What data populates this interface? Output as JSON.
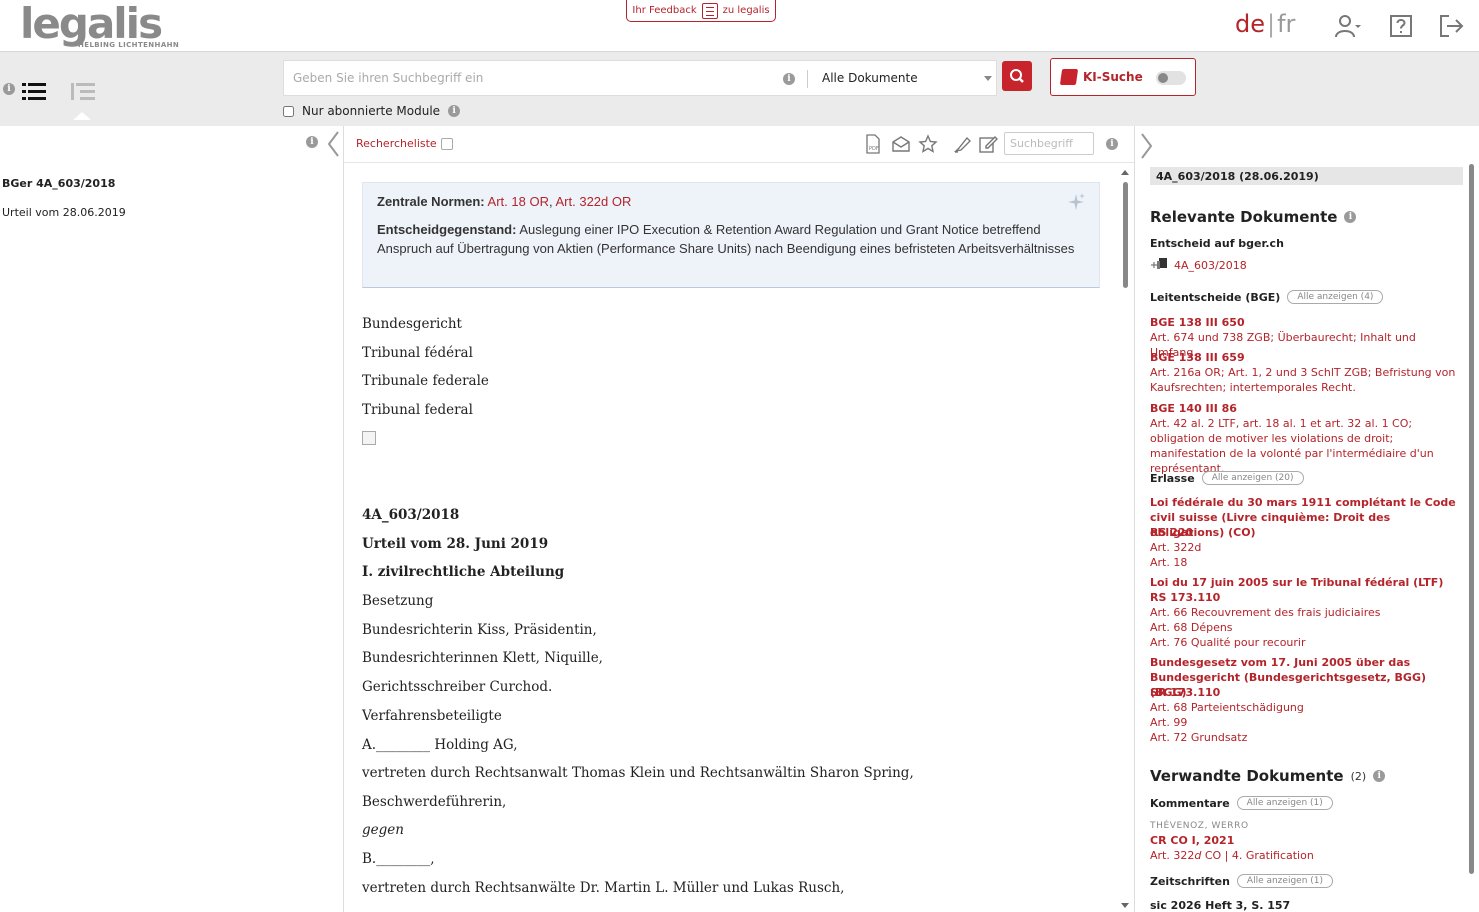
{
  "header": {
    "logo_text": "legalis",
    "logo_sub": "HELBING LICHTENHAHN",
    "feedback_left": "Ihr Feedback",
    "feedback_right": "zu legalis",
    "lang_active": "de",
    "lang_sep": "|",
    "lang_other": "fr",
    "icons": [
      "user-icon",
      "help-icon",
      "logout-icon"
    ]
  },
  "search": {
    "placeholder": "Geben Sie ihren Suchbegriff ein",
    "scope_selected": "Alle Dokumente",
    "ki_label": "KI-Suche",
    "ki_enabled": false,
    "abo_label": "Nur abonnierte Module",
    "abo_checked": false
  },
  "left": {
    "doc_title": "BGer 4A_603/2018",
    "doc_sub": "Urteil vom 28.06.2019"
  },
  "toolbar": {
    "recherche_label": "Rechercheliste",
    "search_placeholder": "Suchbegriff",
    "icons": [
      "pdf-icon",
      "mail-icon",
      "star-icon",
      "highlighter-icon",
      "edit-icon"
    ]
  },
  "summary": {
    "normen_label": "Zentrale Normen:",
    "normen_1": "Art. 18 OR",
    "normen_sep": ",",
    "normen_2": "Art. 322d OR",
    "gegenstand_label": "Entscheidgegenstand:",
    "gegenstand_text": "Auslegung einer IPO Execution & Retention Award Regulation und Grant Notice betreffend Anspruch auf Übertragung von Aktien (Performance Share Units) nach Beendigung eines befristeten Arbeitsverhältnisses"
  },
  "document": {
    "lines": [
      {
        "text": "Bundesgericht",
        "style": "normal"
      },
      {
        "text": "Tribunal fédéral",
        "style": "normal"
      },
      {
        "text": "Tribunale federale",
        "style": "normal"
      },
      {
        "text": "Tribunal federal",
        "style": "normal"
      },
      {
        "text": "4A_603/2018",
        "style": "bold"
      },
      {
        "text": "Urteil vom 28. Juni 2019",
        "style": "bold"
      },
      {
        "text": "I. zivilrechtliche Abteilung",
        "style": "bold"
      },
      {
        "text": "Besetzung",
        "style": "normal"
      },
      {
        "text": "Bundesrichterin Kiss, Präsidentin,",
        "style": "normal"
      },
      {
        "text": "Bundesrichterinnen Klett, Niquille,",
        "style": "normal"
      },
      {
        "text": "Gerichtsschreiber Curchod.",
        "style": "normal"
      },
      {
        "text": "Verfahrensbeteiligte",
        "style": "normal"
      },
      {
        "text": "A.________ Holding AG,",
        "style": "normal"
      },
      {
        "text": "vertreten durch Rechtsanwalt Thomas Klein und Rechtsanwältin Sharon Spring,",
        "style": "normal"
      },
      {
        "text": "Beschwerdeführerin,",
        "style": "normal"
      },
      {
        "text": "gegen",
        "style": "italic"
      },
      {
        "text": "B.________,",
        "style": "normal"
      },
      {
        "text": "vertreten durch Rechtsanwälte Dr. Martin L. Müller und Lukas Rusch,",
        "style": "normal"
      }
    ]
  },
  "right": {
    "header": "4A_603/2018 (28.06.2019)",
    "relevante_title": "Relevante Dokumente",
    "entscheid_title": "Entscheid auf bger.ch",
    "entscheid_link": "4A_603/2018",
    "leitentscheide_title": "Leitentscheide (BGE)",
    "leitentscheide_pill": "Alle anzeigen (4)",
    "bge": [
      {
        "ref": "BGE 138 III 650",
        "desc": "Art. 674 und 738 ZGB; Überbaurecht; Inhalt und Umfang."
      },
      {
        "ref": "BGE 138 III 659",
        "desc": "Art. 216a OR; Art. 1, 2 und 3 SchlT ZGB; Befristung von Kaufsrechten; intertemporales Recht."
      },
      {
        "ref": "BGE 140 III 86",
        "desc": "Art. 42 al. 2 LTF, art. 18 al. 1 et art. 32 al. 1 CO; obligation de motiver les violations de droit; manifestation de la volonté par l'intermédiaire d'un représentant."
      }
    ],
    "erlasse_title": "Erlasse",
    "erlasse_pill": "Alle anzeigen (20)",
    "erlasse": [
      {
        "title": "Loi fédérale du 30 mars 1911 complétant le Code civil suisse (Livre cinquième: Droit des obligations) (CO)",
        "rs": "RS 220",
        "articles": [
          "Art. 322d",
          "Art. 18"
        ]
      },
      {
        "title": "Loi du 17 juin 2005 sur le Tribunal fédéral (LTF)",
        "rs": "RS 173.110",
        "articles": [
          "Art. 66 Recouvrement des frais judiciaires",
          "Art. 68 Dépens",
          "Art. 76 Qualité pour recourir"
        ]
      },
      {
        "title": "Bundesgesetz vom 17. Juni 2005 über das Bundesgericht (Bundesgerichtsgesetz, BGG) (BGG)",
        "rs": "SR 173.110",
        "articles": [
          "Art. 68 Parteientschädigung",
          "Art. 99",
          "Art. 72 Grundsatz"
        ]
      }
    ],
    "verwandte_title": "Verwandte Dokumente",
    "verwandte_count": "(2)",
    "kommentare_title": "Kommentare",
    "kommentare_pill": "Alle anzeigen (1)",
    "kommentar_authors": "THÉVENOZ, WERRO",
    "kommentar_ref": "CR CO I, 2021",
    "kommentar_art": "Art. 322",
    "kommentar_art_suffix": "d",
    "kommentar_rest": " CO | 4. Gratification",
    "zeitschriften_title": "Zeitschriften",
    "zeitschriften_pill": "Alle anzeigen (1)",
    "zeitschrift_ref": "sic 2026 Heft 3, S. 157"
  },
  "colors": {
    "brand_red": "#b4242a",
    "search_bg": "#ebebeb",
    "summary_bg": "#eef3fa"
  }
}
